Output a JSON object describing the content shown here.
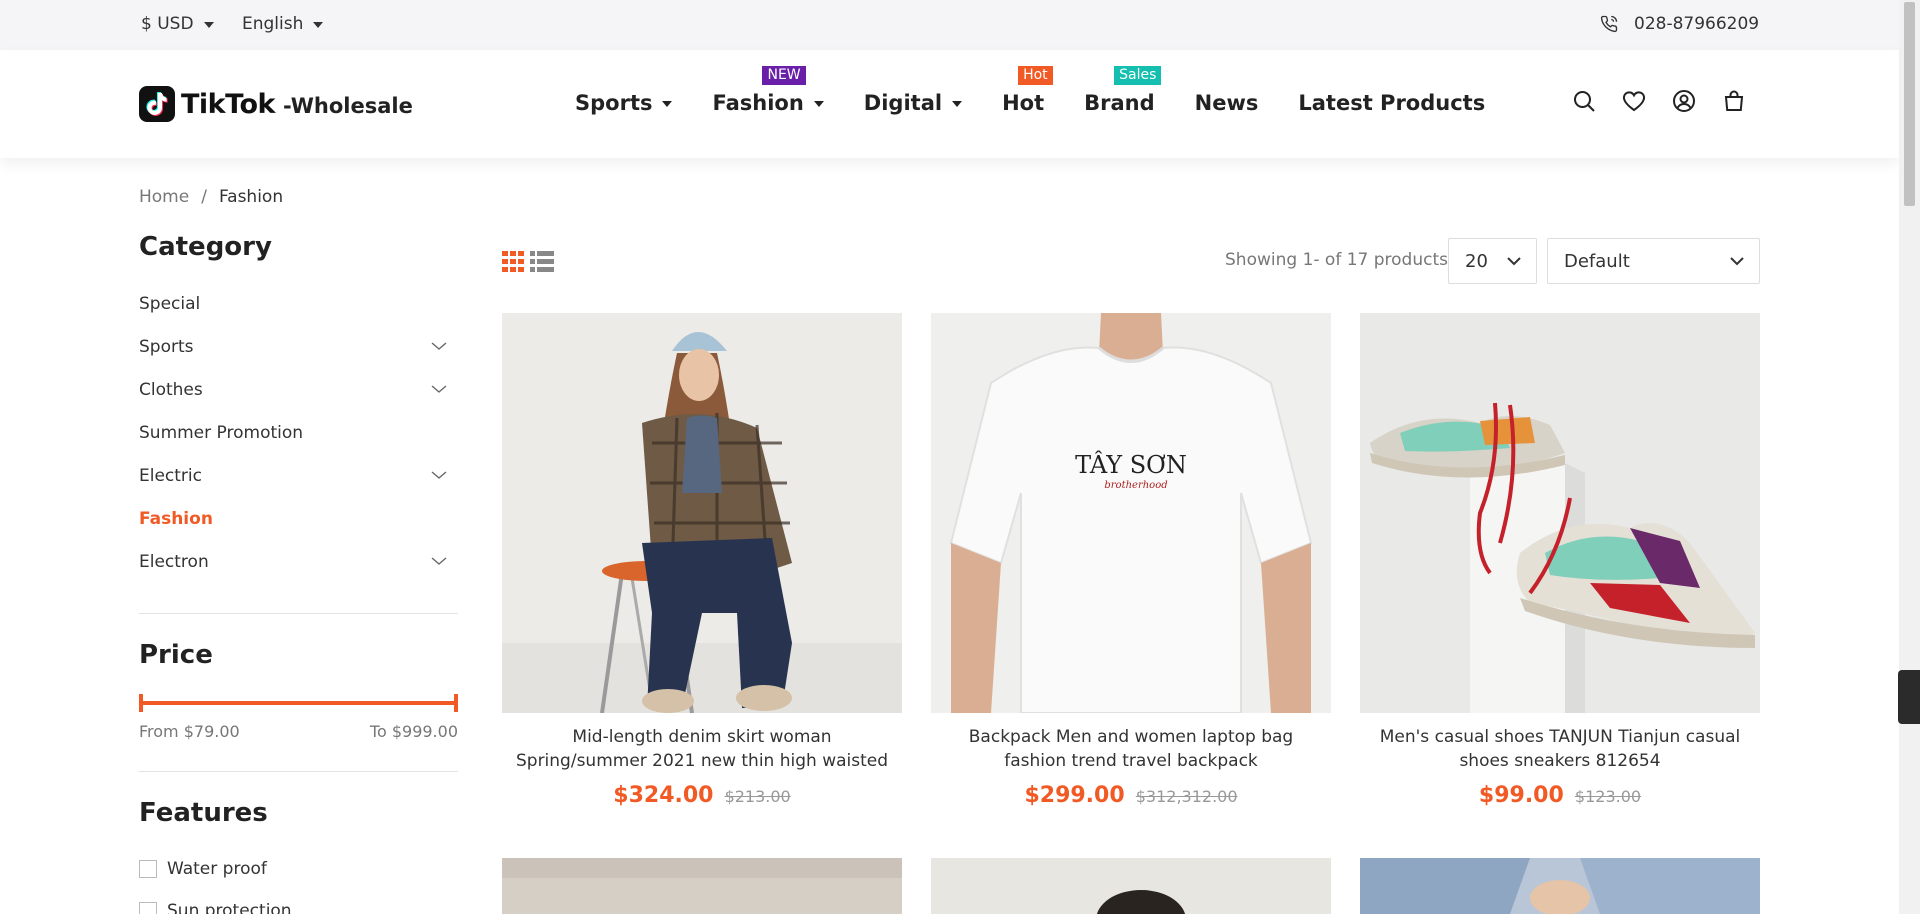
{
  "topbar": {
    "currency": "$ USD",
    "language": "English",
    "phone": "028-87966209"
  },
  "logo": {
    "brand": "TikTok",
    "suffix": "-Wholesale"
  },
  "nav": [
    {
      "label": "Sports",
      "caret": true,
      "badge": "",
      "badge_color": ""
    },
    {
      "label": "Fashion",
      "caret": true,
      "badge": "NEW",
      "badge_color": "#6a1fa8"
    },
    {
      "label": "Digital",
      "caret": true,
      "badge": "",
      "badge_color": ""
    },
    {
      "label": "Hot",
      "caret": false,
      "badge": "Hot",
      "badge_color": "#f15a24"
    },
    {
      "label": "Brand",
      "caret": false,
      "badge": "Sales",
      "badge_color": "#14bfb0"
    },
    {
      "label": "News",
      "caret": false,
      "badge": "",
      "badge_color": ""
    },
    {
      "label": "Latest Products",
      "caret": false,
      "badge": "",
      "badge_color": ""
    }
  ],
  "breadcrumb": {
    "home": "Home",
    "separator": "/",
    "current": "Fashion"
  },
  "sidebar": {
    "category_title": "Category",
    "categories": [
      {
        "label": "Special",
        "expandable": false,
        "active": false
      },
      {
        "label": "Sports",
        "expandable": true,
        "active": false
      },
      {
        "label": "Clothes",
        "expandable": true,
        "active": false
      },
      {
        "label": "Summer Promotion",
        "expandable": false,
        "active": false
      },
      {
        "label": "Electric",
        "expandable": true,
        "active": false
      },
      {
        "label": "Fashion",
        "expandable": false,
        "active": true
      },
      {
        "label": "Electron",
        "expandable": true,
        "active": false
      }
    ],
    "price_title": "Price",
    "price_from": "From $79.00",
    "price_to": "To $999.00",
    "features_title": "Features",
    "features": [
      "Water proof",
      "Sun protection"
    ]
  },
  "toolbar": {
    "showing": "Showing 1- of 17 products",
    "per_page": "20",
    "sort": "Default"
  },
  "products": [
    {
      "name": "Mid-length denim skirt woman Spring/summer 2021 new thin high waisted slit hip wrap skirt A-...",
      "price": "$324.00",
      "old_price": "$213.00"
    },
    {
      "name": "Backpack Men and women laptop bag fashion trend travel backpack",
      "price": "$299.00",
      "old_price": "$312,312.00",
      "shirt_text": "TÂY SƠN",
      "shirt_sub": "brotherhood"
    },
    {
      "name": "Men's casual shoes TANJUN Tianjun casual shoes sneakers 812654",
      "price": "$99.00",
      "old_price": "$123.00"
    }
  ],
  "colors": {
    "accent": "#f15a24",
    "topbar_bg": "#f5f5f7"
  }
}
